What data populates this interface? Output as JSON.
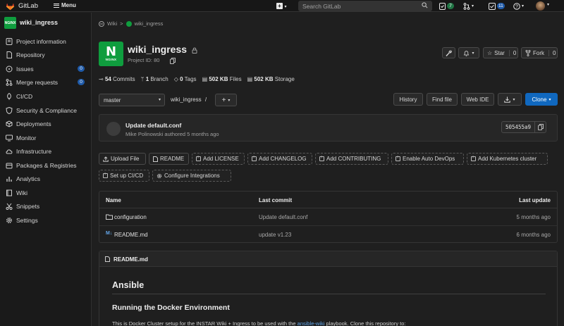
{
  "topbar": {
    "brand": "GitLab",
    "menu_label": "Menu",
    "plus_label": "+",
    "search_placeholder": "Search GitLab",
    "merge_requests_count": "7",
    "todos_count": "11"
  },
  "sidebar": {
    "project_title": "wiki_ingress",
    "project_logo_text": "NGINX",
    "items": [
      {
        "label": "Project information",
        "icon": "info-icon"
      },
      {
        "label": "Repository",
        "icon": "doc-icon"
      },
      {
        "label": "Issues",
        "icon": "issues-icon",
        "count": "0"
      },
      {
        "label": "Merge requests",
        "icon": "merge-icon",
        "count": "0"
      },
      {
        "label": "CI/CD",
        "icon": "rocket-icon"
      },
      {
        "label": "Security & Compliance",
        "icon": "shield-icon"
      },
      {
        "label": "Deployments",
        "icon": "deploy-icon"
      },
      {
        "label": "Monitor",
        "icon": "monitor-icon"
      },
      {
        "label": "Infrastructure",
        "icon": "cloud-icon"
      },
      {
        "label": "Packages & Registries",
        "icon": "package-icon"
      },
      {
        "label": "Analytics",
        "icon": "chart-icon"
      },
      {
        "label": "Wiki",
        "icon": "book-icon"
      },
      {
        "label": "Snippets",
        "icon": "scissors-icon"
      },
      {
        "label": "Settings",
        "icon": "gear-icon"
      }
    ]
  },
  "breadcrumb": {
    "root": "Wiki",
    "separator": ">",
    "current": "wiki_ingress"
  },
  "project": {
    "name": "wiki_ingress",
    "id_label": "Project ID: 80",
    "logo_main": "N",
    "logo_text": "NGINX",
    "star_label": "Star",
    "star_count": "0",
    "fork_label": "Fork",
    "fork_count": "0"
  },
  "stats": {
    "commits_count": "54",
    "commits_label": "Commits",
    "branches_count": "1",
    "branches_label": "Branch",
    "tags_count": "0",
    "tags_label": "Tags",
    "files_size": "502 KB",
    "files_label": "Files",
    "storage_size": "502 KB",
    "storage_label": "Storage"
  },
  "repo_bar": {
    "branch": "master",
    "path": "wiki_ingress",
    "path_sep": "/",
    "add_label": "+",
    "history_label": "History",
    "find_file_label": "Find file",
    "web_ide_label": "Web IDE",
    "clone_label": "Clone"
  },
  "last_commit": {
    "title": "Update default.conf",
    "meta": "Mike Polinowski authored 5 months ago",
    "sha": "505455a9"
  },
  "quick_actions": [
    "Upload File",
    "README",
    "Add LICENSE",
    "Add CHANGELOG",
    "Add CONTRIBUTING",
    "Enable Auto DevOps",
    "Add Kubernetes cluster",
    "Set up CI/CD",
    "Configure Integrations"
  ],
  "files_table": {
    "headers": {
      "name": "Name",
      "commit": "Last commit",
      "update": "Last update"
    },
    "rows": [
      {
        "name": "configuration",
        "commit": "Update default.conf",
        "update": "5 months ago",
        "icon": "folder-icon"
      },
      {
        "name": "README.md",
        "commit": "update v1.23",
        "update": "6 months ago",
        "icon": "markdown-icon"
      }
    ]
  },
  "readme": {
    "filename": "README.md",
    "h1": "Ansible",
    "h2": "Running the Docker Environment",
    "para_before": "This is Docker Cluster setup for the INSTAR Wiki + Ingress to be used with the ",
    "para_link": "ansible-wiki",
    "para_after": " playbook. Clone this repository to:"
  },
  "colors": {
    "accent": "#1068bf",
    "brand_green": "#0f9d3e",
    "link": "#63a6e9"
  }
}
